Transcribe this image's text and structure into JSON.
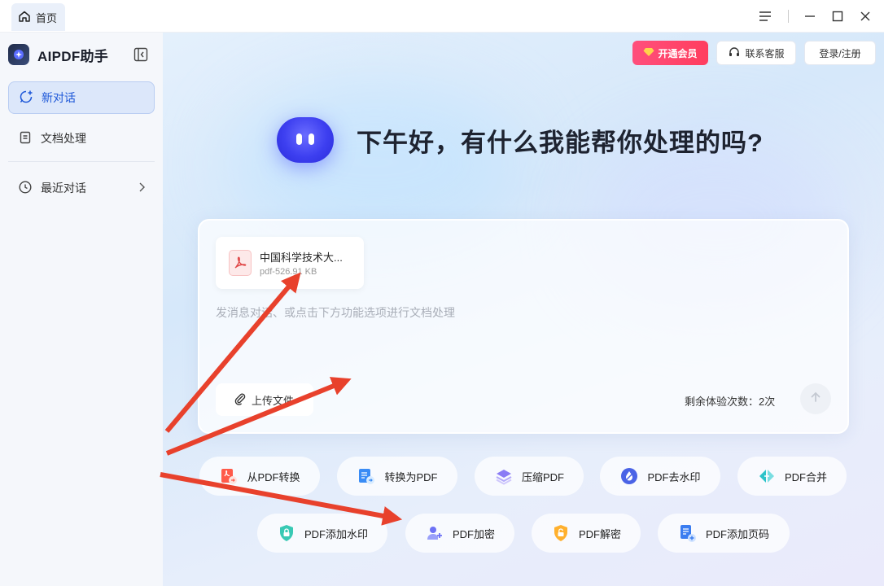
{
  "tabbar": {
    "home_tab": "首页",
    "icons": [
      "home-icon",
      "menu-icon",
      "minimize-icon",
      "maximize-icon",
      "close-icon"
    ]
  },
  "sidebar": {
    "brand": "AIPDF助手",
    "items": [
      {
        "label": "新对话",
        "icon": "new-chat-icon",
        "active": true
      },
      {
        "label": "文档处理",
        "icon": "document-icon",
        "active": false
      },
      {
        "label": "最近对话",
        "icon": "clock-icon",
        "active": false
      }
    ]
  },
  "header": {
    "vip": "开通会员",
    "support": "联系客服",
    "login": "登录/注册"
  },
  "greeting": "下午好，有什么我能帮你处理的吗?",
  "chat": {
    "file": {
      "name": "中国科学技术大...",
      "meta": "pdf-526.91 KB"
    },
    "placeholder": "发消息对话、或点击下方功能选项进行文档处理",
    "upload_label": "上传文件",
    "remaining": "剩余体验次数：2次"
  },
  "tools": [
    {
      "label": "从PDF转换",
      "icon": "pdf-convert-icon"
    },
    {
      "label": "转换为PDF",
      "icon": "to-pdf-icon"
    },
    {
      "label": "压缩PDF",
      "icon": "compress-icon"
    },
    {
      "label": "PDF去水印",
      "icon": "remove-watermark-icon"
    },
    {
      "label": "PDF合并",
      "icon": "merge-icon"
    },
    {
      "label": "PDF添加水印",
      "icon": "add-watermark-icon"
    },
    {
      "label": "PDF加密",
      "icon": "encrypt-icon"
    },
    {
      "label": "PDF解密",
      "icon": "decrypt-icon"
    },
    {
      "label": "PDF添加页码",
      "icon": "page-number-icon"
    }
  ],
  "colors": {
    "accent": "#1d57d8",
    "vip": "#ff3d5e",
    "annotation": "#e8412c"
  }
}
